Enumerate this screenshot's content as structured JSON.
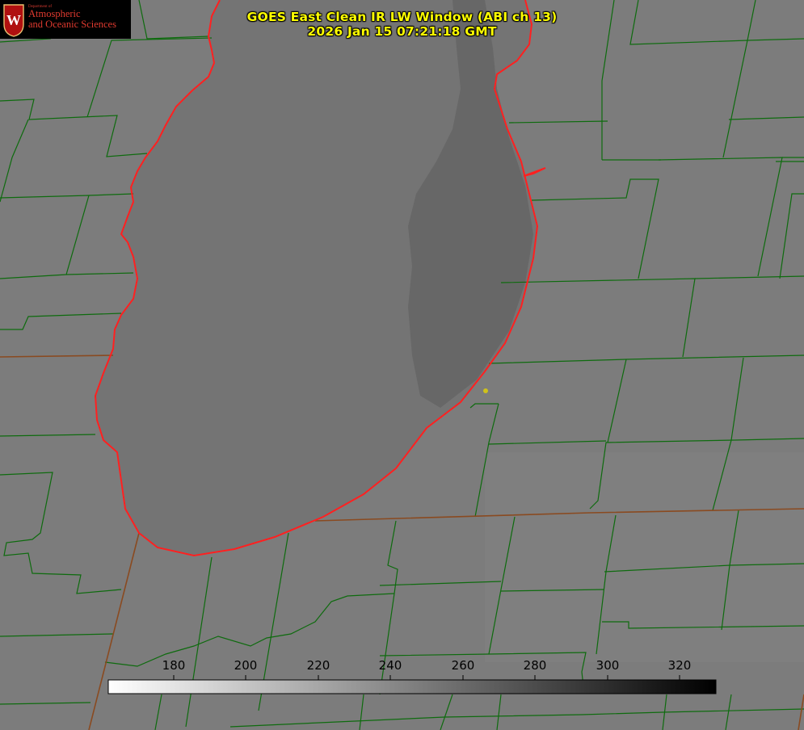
{
  "logo": {
    "department": "Department of",
    "line1": "Atmospheric",
    "line2": "and Oceanic Sciences",
    "seal_letter": "W"
  },
  "title": {
    "line1": "GOES East Clean IR LW Window (ABI ch 13)",
    "line2": "2026 Jan 15 07:21:18 GMT"
  },
  "colorbar": {
    "ticks": [
      "180",
      "200",
      "220",
      "240",
      "260",
      "280",
      "300",
      "320"
    ],
    "range_low_color": "#ffffff",
    "range_high_color": "#000000"
  },
  "colors": {
    "background": "#7c7c7c",
    "lake_fill": "#747474",
    "county_lines": "#0e6b0e",
    "state_lines": "#8a4a20",
    "coastline": "#ff2020",
    "title_text": "#ffff00",
    "marker": "#cfc21a"
  }
}
